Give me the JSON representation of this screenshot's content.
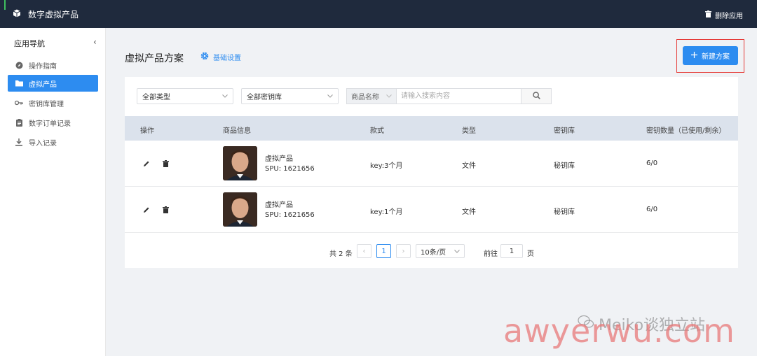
{
  "topbar": {
    "app_title": "数字虚拟产品",
    "delete_app_label": "删除应用"
  },
  "sidebar": {
    "title": "应用导航",
    "items": [
      {
        "label": "操作指南",
        "icon": "compass-icon",
        "active": false
      },
      {
        "label": "虚拟产品",
        "icon": "folder-icon",
        "active": true
      },
      {
        "label": "密钥库管理",
        "icon": "key-icon",
        "active": false
      },
      {
        "label": "数字订单记录",
        "icon": "clipboard-icon",
        "active": false
      },
      {
        "label": "导入记录",
        "icon": "download-icon",
        "active": false
      }
    ]
  },
  "main": {
    "title": "虚拟产品方案",
    "basic_settings_label": "基础设置",
    "new_plan_label": "新建方案"
  },
  "filters": {
    "type_select": "全部类型",
    "keystore_select": "全部密钥库",
    "search_field": "商品名称",
    "search_placeholder": "请输入搜索内容"
  },
  "table": {
    "headers": [
      "操作",
      "商品信息",
      "款式",
      "类型",
      "密钥库",
      "密钥数量（已使用/剩余）"
    ],
    "rows": [
      {
        "product_name": "虚拟产品",
        "spu": "SPU: 1621656",
        "style": "key:3个月",
        "type": "文件",
        "keystore": "秘钥库",
        "key_count": "6/0"
      },
      {
        "product_name": "虚拟产品",
        "spu": "SPU: 1621656",
        "style": "key:1个月",
        "type": "文件",
        "keystore": "秘钥库",
        "key_count": "6/0"
      }
    ]
  },
  "pagination": {
    "total": "共 2 条",
    "current_page": "1",
    "page_size": "10条/页",
    "goto_label": "前往",
    "goto_value": "1",
    "page_unit": "页"
  },
  "watermark": {
    "text": "awyerwu.com",
    "account": "Meiko谈独立站"
  },
  "colors": {
    "primary": "#2d8cf0",
    "topbar": "#1f2a3d",
    "highlight_frame": "#e53935"
  }
}
